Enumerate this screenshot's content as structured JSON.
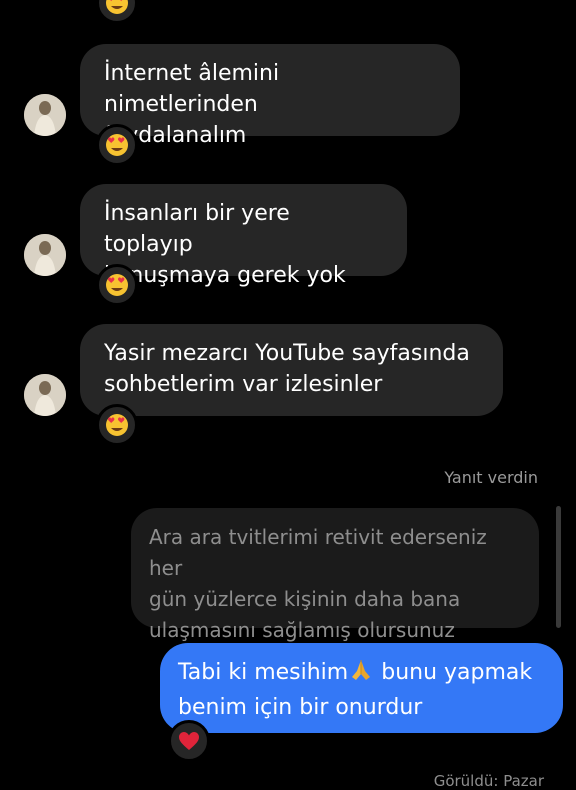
{
  "messages": [
    {
      "text_lines": [
        "İnternet âlemini nimetlerinden",
        "faydalanalım"
      ],
      "reaction": "heart-eyes"
    },
    {
      "text_lines": [
        "İnsanları bir yere toplayıp",
        "konuşmaya gerek yok"
      ],
      "reaction": "heart-eyes"
    },
    {
      "text_lines": [
        "Yasir mezarcı YouTube sayfasında",
        "sohbetlerim var izlesinler"
      ],
      "reaction": "heart-eyes"
    }
  ],
  "reply": {
    "label": "Yanıt verdin",
    "quoted_lines": [
      "Ara ara tvitlerimi retivit ederseniz her",
      "gün yüzlerce kişinin daha bana",
      "ulaşmasını sağlamış olursunuz"
    ],
    "sent_line1_before_emoji": "Tabi ki mesihim",
    "sent_line1_after_emoji": " bunu yapmak",
    "sent_line2": "benim için bir onurdur",
    "reaction": "red-heart"
  },
  "seen_status": "Görüldü: Pazar",
  "colors": {
    "background": "#000000",
    "incoming_bubble": "#262626",
    "outgoing_bubble": "#3478f6"
  }
}
